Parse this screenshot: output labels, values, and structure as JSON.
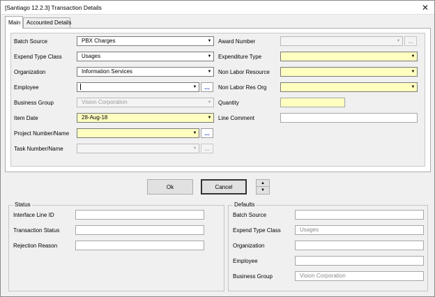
{
  "window": {
    "title": "[Santiago 12.2.3] Transaction Details",
    "close_glyph": "✕"
  },
  "tabs": [
    {
      "label": "Main",
      "active": true
    },
    {
      "label": "Accounted Details",
      "active": false
    }
  ],
  "main": {
    "batch_source": {
      "label": "Batch Source",
      "value": "PBX Charges"
    },
    "expend_type_class": {
      "label": "Expend Type Class",
      "value": "Usages"
    },
    "organization": {
      "label": "Organization",
      "value": "Information Services"
    },
    "employee": {
      "label": "Employee",
      "value": ""
    },
    "business_group": {
      "label": "Business Group",
      "value": "Vision Corporation"
    },
    "item_date": {
      "label": "Item Date",
      "value": "28-Aug-18"
    },
    "project_number": {
      "label": "Project Number/Name",
      "value": ""
    },
    "task_number": {
      "label": "Task Number/Name",
      "value": ""
    },
    "award_number": {
      "label": "Award Number",
      "value": ""
    },
    "expenditure_type": {
      "label": "Expenditure Type",
      "value": ""
    },
    "non_labor_resource": {
      "label": "Non Labor Resource",
      "value": ""
    },
    "non_labor_res_org": {
      "label": "Non Labor Res Org",
      "value": ""
    },
    "quantity": {
      "label": "Quantity",
      "value": ""
    },
    "line_comment": {
      "label": "Line Comment",
      "value": ""
    },
    "dropdown_glyph": "▼",
    "lov_glyph": "...",
    "colors": {
      "required": "#ffffc0",
      "lov_dots": "#1f3fbf"
    }
  },
  "buttons": {
    "ok": "Ok",
    "cancel": "Cancel",
    "up_glyph": "▲",
    "down_glyph": "▼"
  },
  "status": {
    "title": "Status",
    "interface_line_id": {
      "label": "Interface Line ID",
      "value": ""
    },
    "transaction_status": {
      "label": "Transaction Status",
      "value": ""
    },
    "rejection_reason": {
      "label": "Rejection Reason",
      "value": ""
    }
  },
  "defaults": {
    "title": "Defaults",
    "batch_source": {
      "label": "Batch Source",
      "value": ""
    },
    "expend_type_class": {
      "label": "Expend Type Class",
      "value": "Usages"
    },
    "organization": {
      "label": "Organization",
      "value": ""
    },
    "employee": {
      "label": "Employee",
      "value": ""
    },
    "business_group": {
      "label": "Business Group",
      "value": "Vision Corporation"
    }
  }
}
